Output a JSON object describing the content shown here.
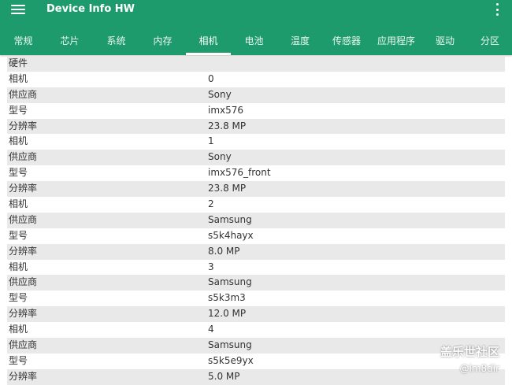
{
  "appbar": {
    "title": "Device Info HW"
  },
  "tabs": [
    {
      "label": "常规",
      "active": false
    },
    {
      "label": "芯片",
      "active": false
    },
    {
      "label": "系统",
      "active": false
    },
    {
      "label": "内存",
      "active": false
    },
    {
      "label": "相机",
      "active": true
    },
    {
      "label": "电池",
      "active": false
    },
    {
      "label": "温度",
      "active": false
    },
    {
      "label": "传感器",
      "active": false
    },
    {
      "label": "应用程序",
      "active": false
    },
    {
      "label": "驱动",
      "active": false
    },
    {
      "label": "分区",
      "active": false
    }
  ],
  "rows": [
    {
      "label": "硬件",
      "value": ""
    },
    {
      "label": "相机",
      "value": "0"
    },
    {
      "label": "供应商",
      "value": "Sony"
    },
    {
      "label": "型号",
      "value": "imx576"
    },
    {
      "label": "分辨率",
      "value": "23.8 MP"
    },
    {
      "label": "相机",
      "value": "1"
    },
    {
      "label": "供应商",
      "value": "Sony"
    },
    {
      "label": "型号",
      "value": "imx576_front"
    },
    {
      "label": "分辨率",
      "value": "23.8 MP"
    },
    {
      "label": "相机",
      "value": "2"
    },
    {
      "label": "供应商",
      "value": "Samsung"
    },
    {
      "label": "型号",
      "value": "s5k4hayx"
    },
    {
      "label": "分辨率",
      "value": "8.0 MP"
    },
    {
      "label": "相机",
      "value": "3"
    },
    {
      "label": "供应商",
      "value": "Samsung"
    },
    {
      "label": "型号",
      "value": "s5k3m3"
    },
    {
      "label": "分辨率",
      "value": "12.0 MP"
    },
    {
      "label": "相机",
      "value": "4"
    },
    {
      "label": "供应商",
      "value": "Samsung"
    },
    {
      "label": "型号",
      "value": "s5k5e9yx"
    },
    {
      "label": "分辨率",
      "value": "5.0 MP"
    }
  ],
  "watermark": {
    "brand": "盖乐世社区",
    "user": "@lm8dir"
  },
  "colors": {
    "primary": "#1e9b6c",
    "row_alt": "#e9e9e9",
    "text": "#333333"
  }
}
